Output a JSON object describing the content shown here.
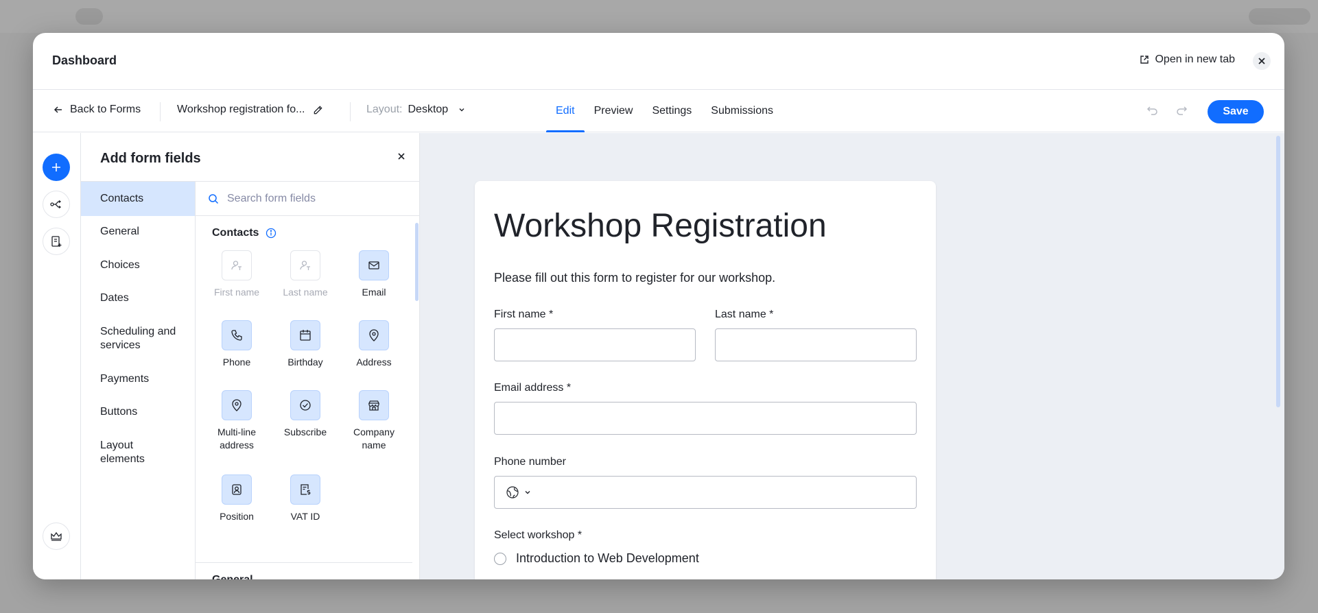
{
  "modal": {
    "title": "Dashboard",
    "open_new_tab": "Open in new tab"
  },
  "toolbar": {
    "back_label": "Back to Forms",
    "form_name": "Workshop registration fo...",
    "layout_label": "Layout:",
    "layout_value": "Desktop",
    "tabs": [
      {
        "label": "Edit",
        "active": true
      },
      {
        "label": "Preview",
        "active": false
      },
      {
        "label": "Settings",
        "active": false
      },
      {
        "label": "Submissions",
        "active": false
      }
    ],
    "save_label": "Save"
  },
  "panel": {
    "title": "Add form fields",
    "search_placeholder": "Search form fields",
    "categories": [
      {
        "label": "Contacts",
        "active": true
      },
      {
        "label": "General",
        "active": false
      },
      {
        "label": "Choices",
        "active": false
      },
      {
        "label": "Dates",
        "active": false
      },
      {
        "label": "Scheduling and services",
        "active": false
      },
      {
        "label": "Payments",
        "active": false
      },
      {
        "label": "Buttons",
        "active": false
      },
      {
        "label": "Layout elements",
        "active": false
      }
    ],
    "contacts_section": "Contacts",
    "general_section": "General",
    "fields": [
      {
        "label": "First name",
        "icon": "person-text-icon",
        "disabled": true
      },
      {
        "label": "Last name",
        "icon": "person-text-icon",
        "disabled": true
      },
      {
        "label": "Email",
        "icon": "envelope-icon",
        "disabled": false
      },
      {
        "label": "Phone",
        "icon": "phone-icon",
        "disabled": false
      },
      {
        "label": "Birthday",
        "icon": "calendar-icon",
        "disabled": false
      },
      {
        "label": "Address",
        "icon": "location-pin-icon",
        "disabled": false
      },
      {
        "label": "Multi-line address",
        "icon": "location-pin-icon",
        "disabled": false
      },
      {
        "label": "Subscribe",
        "icon": "check-circle-icon",
        "disabled": false
      },
      {
        "label": "Company name",
        "icon": "storefront-icon",
        "disabled": false
      },
      {
        "label": "Position",
        "icon": "person-badge-icon",
        "disabled": false
      },
      {
        "label": "VAT ID",
        "icon": "invoice-dollar-icon",
        "disabled": false
      }
    ]
  },
  "form": {
    "heading": "Workshop Registration",
    "description": "Please fill out this form to register for our workshop.",
    "first_name_label": "First name *",
    "last_name_label": "Last name *",
    "email_label": "Email address *",
    "phone_label": "Phone number",
    "workshop_label": "Select workshop *",
    "workshop_option_1": "Introduction to Web Development"
  },
  "colors": {
    "accent": "#116dff",
    "accent_light": "#d6e6fe",
    "canvas_bg": "#eceff4"
  }
}
